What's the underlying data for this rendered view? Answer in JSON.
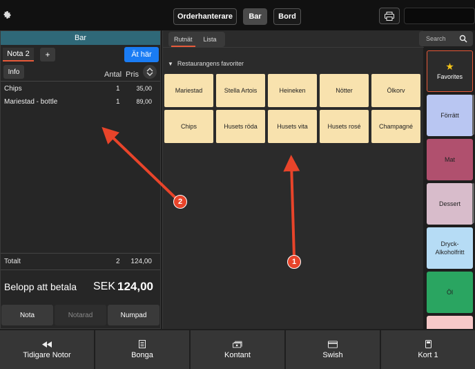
{
  "topbar": {
    "tabs": [
      {
        "label": "Orderhanterare"
      },
      {
        "label": "Bar"
      },
      {
        "label": "Bord"
      }
    ]
  },
  "order": {
    "title": "Bar",
    "nota_tab": "Nota 2",
    "add_label": "+",
    "eat_here": "Ät här",
    "info": "Info",
    "col_qty": "Antal",
    "col_price": "Pris",
    "items": [
      {
        "name": "Chips",
        "qty": "1",
        "price": "35,00"
      },
      {
        "name": "Mariestad - bottle",
        "qty": "1",
        "price": "89,00"
      }
    ],
    "total_label": "Totalt",
    "total_qty": "2",
    "total_price": "124,00",
    "due_label": "Belopp att betala",
    "currency": "SEK",
    "due_amount": "124,00",
    "actions": [
      {
        "label": "Nota",
        "enabled": true
      },
      {
        "label": "Notarad",
        "enabled": false
      },
      {
        "label": "Numpad",
        "enabled": true
      }
    ]
  },
  "catalog": {
    "tabs": [
      {
        "label": "Rutnät",
        "active": true
      },
      {
        "label": "Lista",
        "active": false
      }
    ],
    "favorites_heading": "Restaurangens favoriter",
    "products": [
      "Mariestad",
      "Stella Artois",
      "Heineken",
      "Nötter",
      "Ölkorv",
      "Chips",
      "Husets röda",
      "Husets vita",
      "Husets rosé",
      "Champagné"
    ]
  },
  "search": {
    "placeholder": "Search"
  },
  "categories": [
    {
      "label": "Favorites",
      "color": "#2b2b2b"
    },
    {
      "label": "Förrätt",
      "color": "#b9c6f2"
    },
    {
      "label": "Mat",
      "color": "#b0506e"
    },
    {
      "label": "Dessert",
      "color": "#d8bccb"
    },
    {
      "label": "Dryck-Alkoholfritt",
      "color": "#b6dcf5"
    },
    {
      "label": "Öl",
      "color": "#2aa561"
    },
    {
      "label": "",
      "color": "#f6c8c8"
    }
  ],
  "payments": [
    {
      "label": "Tidigare Notor",
      "icon": "rewind-icon"
    },
    {
      "label": "Bonga",
      "icon": "receipt-icon"
    },
    {
      "label": "Kontant",
      "icon": "cash-icon"
    },
    {
      "label": "Swish",
      "icon": "card-icon"
    },
    {
      "label": "Kort 1",
      "icon": "card-terminal-icon"
    }
  ],
  "annotations": [
    "1",
    "2"
  ],
  "colors": {
    "accent": "#e85a3a",
    "blue": "#1a7cf4",
    "header": "#2f6878",
    "product": "#f8e2ae"
  }
}
